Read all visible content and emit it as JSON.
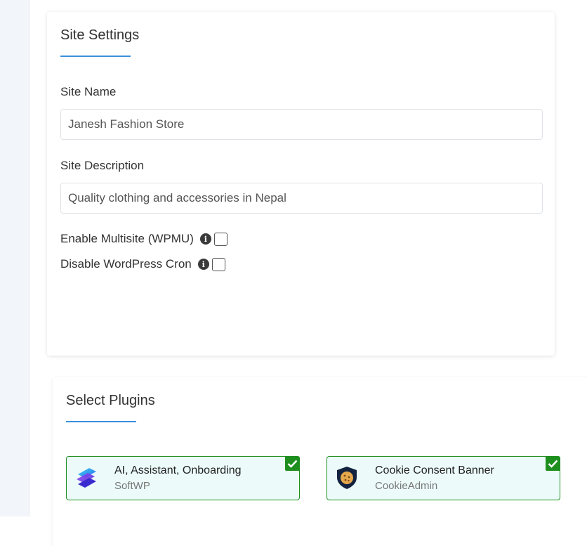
{
  "site_settings": {
    "title": "Site Settings",
    "site_name_label": "Site Name",
    "site_name_value": "Janesh Fashion Store",
    "site_description_label": "Site Description",
    "site_description_value": "Quality clothing and accessories in Nepal",
    "multisite_label": "Enable Multisite (WPMU)",
    "disable_cron_label": "Disable WordPress Cron",
    "info_glyph": "i"
  },
  "plugins": {
    "title": "Select Plugins",
    "items": [
      {
        "name": "AI, Assistant, Onboarding",
        "author": "SoftWP",
        "icon": "softwp-layers-icon",
        "selected": true
      },
      {
        "name": "Cookie Consent Banner",
        "author": "CookieAdmin",
        "icon": "cookie-shield-icon",
        "selected": true
      }
    ]
  },
  "colors": {
    "accent": "#3b8fdb",
    "selected_border": "#1e8f1e",
    "selected_bg": "#ecfbfa"
  }
}
